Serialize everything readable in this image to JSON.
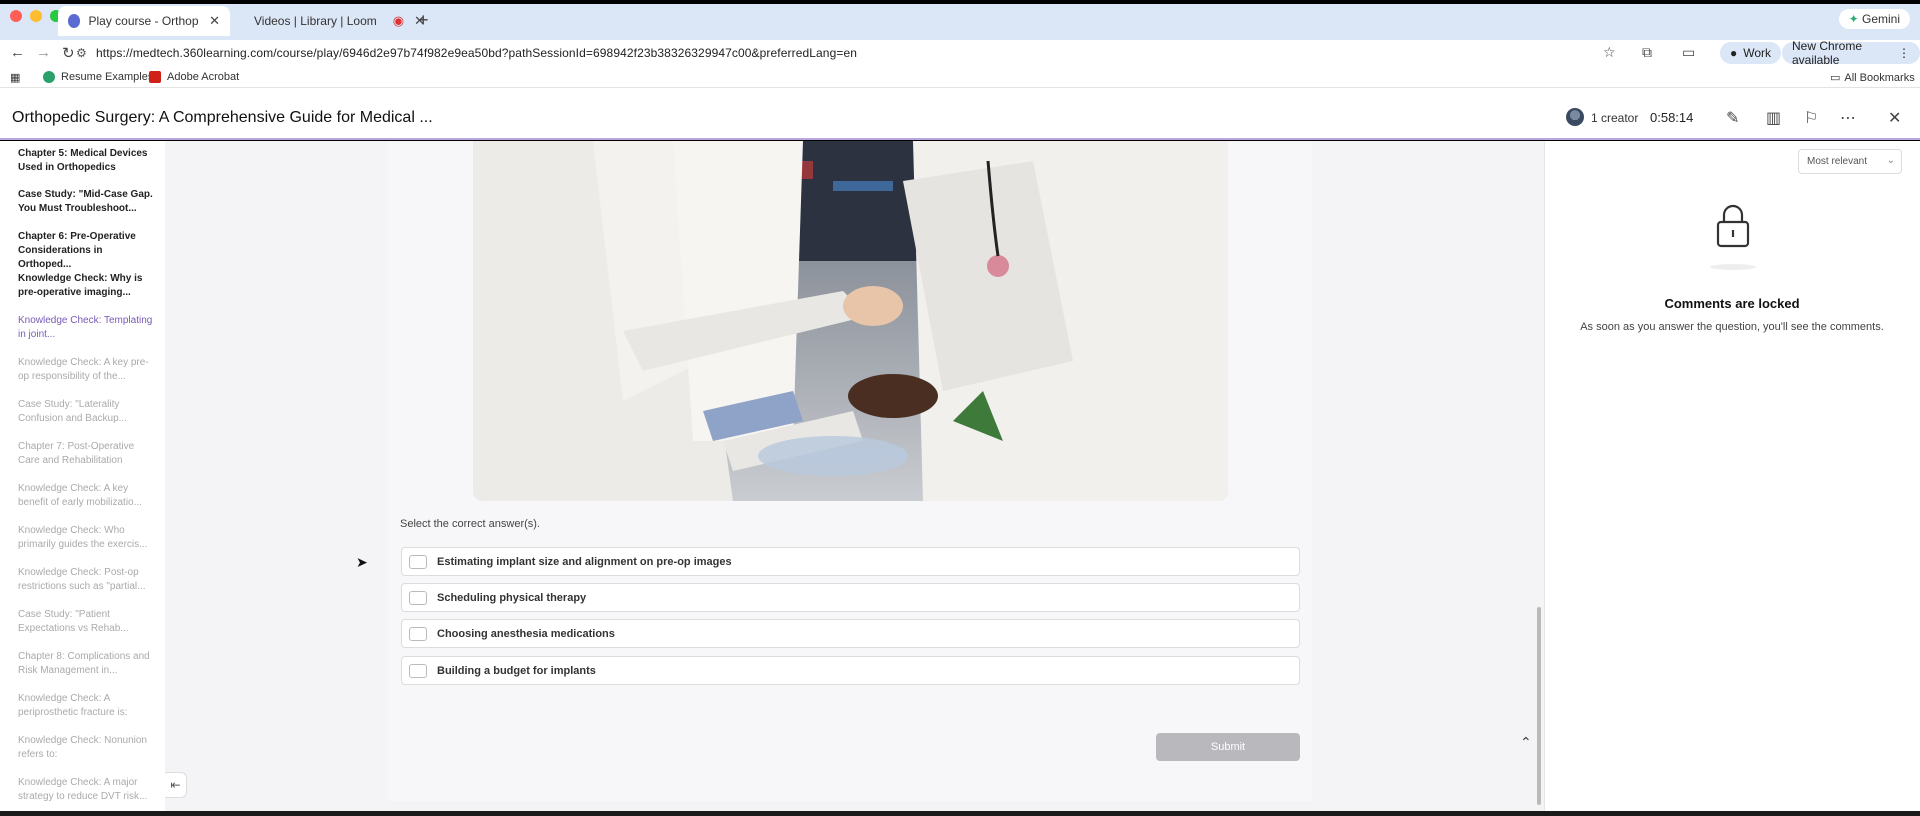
{
  "browser": {
    "tabs": [
      {
        "title": "Play course - Orthopedic Sur",
        "active": true
      },
      {
        "title": "Videos | Library | Loom",
        "active": false
      }
    ],
    "gemini_label": "Gemini",
    "url": "https://medtech.360learning.com/course/play/6946d2e97b74f982e9ea50bd?pathSessionId=698942f23b38326329947c00&preferredLang=en",
    "profile_label": "Work",
    "update_label": "New Chrome available",
    "bookmarks": [
      "Resume Examples",
      "Adobe Acrobat"
    ],
    "all_bookmarks_label": "All Bookmarks"
  },
  "header": {
    "course_title": "Orthopedic Surgery: A Comprehensive Guide for Medical ...",
    "creators_label": "1 creator",
    "timer": "0:58:14"
  },
  "sidebar": {
    "items": [
      {
        "label": "Chapter 5: Medical Devices Used in Orthopedics",
        "state": "done"
      },
      {
        "label": "Case Study: \"Mid-Case Gap. You Must Troubleshoot...",
        "state": "done"
      },
      {
        "label": "Chapter 6: Pre-Operative Considerations in Orthoped...",
        "state": "done"
      },
      {
        "label": "Knowledge Check: Why is pre-operative imaging...",
        "state": "done"
      },
      {
        "label": "Knowledge Check: Templating in joint...",
        "state": "current"
      },
      {
        "label": "Knowledge Check: A key pre-op responsibility of the...",
        "state": "locked"
      },
      {
        "label": "Case Study: \"Laterality Confusion and Backup...",
        "state": "locked"
      },
      {
        "label": "Chapter 7: Post-Operative Care and Rehabilitation",
        "state": "locked"
      },
      {
        "label": "Knowledge Check: A key benefit of early mobilizatio...",
        "state": "locked"
      },
      {
        "label": "Knowledge Check: Who primarily guides the exercis...",
        "state": "locked"
      },
      {
        "label": "Knowledge Check: Post-op restrictions such as \"partial...",
        "state": "locked"
      },
      {
        "label": "Case Study: \"Patient Expectations vs Rehab...",
        "state": "locked"
      },
      {
        "label": "Chapter 8: Complications and Risk Management in...",
        "state": "locked"
      },
      {
        "label": "Knowledge Check: A periprosthetic fracture is:",
        "state": "locked"
      },
      {
        "label": "Knowledge Check: Nonunion refers to:",
        "state": "locked"
      },
      {
        "label": "Knowledge Check: A major strategy to reduce DVT risk...",
        "state": "locked"
      }
    ]
  },
  "question": {
    "prompt": "Select the correct answer(s).",
    "options": [
      "Estimating implant size and alignment on pre-op images",
      "Scheduling physical therapy",
      "Choosing anesthesia medications",
      "Building a budget for implants"
    ],
    "submit_label": "Submit"
  },
  "comments": {
    "sort_label": "Most relevant",
    "locked_title": "Comments are locked",
    "locked_subtitle": "As soon as you answer the question, you'll see the comments."
  }
}
